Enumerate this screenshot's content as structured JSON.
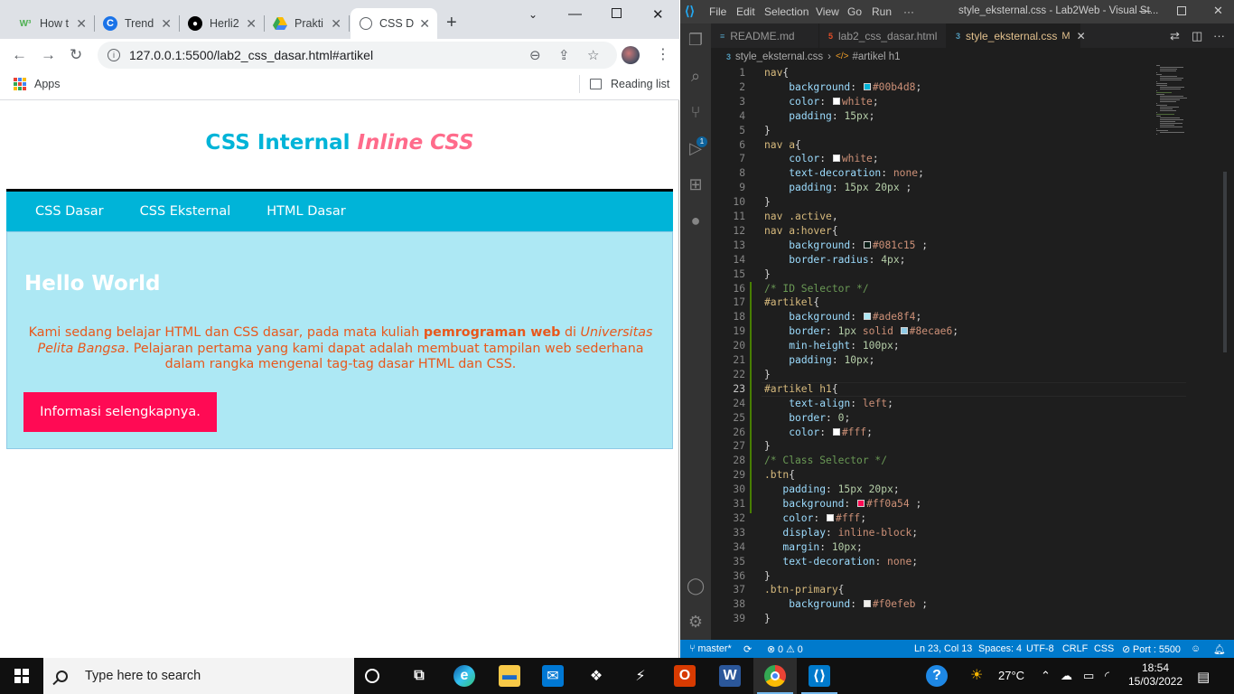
{
  "browser": {
    "tabs": [
      {
        "title": "How t",
        "favicon": "W³",
        "favicon_bg": "#ffffff",
        "favicon_color": "#4caf50"
      },
      {
        "title": "Trend",
        "favicon": "C",
        "favicon_bg": "#1a73e8",
        "favicon_color": "#ffffff"
      },
      {
        "title": "Herli2",
        "favicon": "github",
        "favicon_bg": "#ffffff",
        "favicon_color": "#000000"
      },
      {
        "title": "Prakti",
        "favicon": "drive",
        "favicon_bg": "#ffffff",
        "favicon_color": "#fbbc04"
      },
      {
        "title": "CSS D",
        "favicon": "globe",
        "favicon_bg": "#ffffff",
        "favicon_color": "#5f6368",
        "active": true
      }
    ],
    "url": "127.0.0.1:5500/lab2_css_dasar.html#artikel",
    "bookmarks": {
      "apps": "Apps",
      "reading_list": "Reading list"
    }
  },
  "page": {
    "title_main": "CSS Internal",
    "title_inline": "Inline CSS",
    "nav": [
      "CSS Dasar",
      "CSS Eksternal",
      "HTML Dasar"
    ],
    "article": {
      "heading": "Hello World",
      "p1": "Kami sedang belajar HTML dan CSS dasar, pada mata kuliah ",
      "bold": "pemrograman web",
      "p2": " di ",
      "italic": "Universitas Pelita Bangsa",
      "p3": ". Pelajaran pertama yang kami dapat adalah membuat tampilan web sederhana dalam rangka mengenal tag-tag dasar HTML dan CSS.",
      "button": "Informasi selengkapnya."
    },
    "colors": {
      "nav": "#00b4d8",
      "article_bg": "#ade8f4",
      "button": "#ff0a54",
      "text": "#e8581c"
    }
  },
  "vscode": {
    "menu": [
      "File",
      "Edit",
      "Selection",
      "View",
      "Go",
      "Run",
      "···"
    ],
    "window_title": "style_eksternal.css - Lab2Web - Visual St...",
    "tabs": [
      {
        "label": "README.md",
        "icon": "MD"
      },
      {
        "label": "lab2_css_dasar.html",
        "icon": "5"
      },
      {
        "label": "style_eksternal.css",
        "icon": "3",
        "modified": "M",
        "active": true
      }
    ],
    "breadcrumb": {
      "file": "style_eksternal.css",
      "symbol": "#artikel h1"
    },
    "current_line": 23,
    "code": [
      [
        [
          "sel",
          "nav"
        ],
        [
          "pun",
          "{"
        ]
      ],
      [
        [
          "ind",
          "    "
        ],
        [
          "prop",
          "background"
        ],
        [
          "pun",
          ": "
        ],
        [
          "sw",
          "#00b4d8"
        ],
        [
          "val",
          "#00b4d8"
        ],
        [
          "pun",
          ";"
        ]
      ],
      [
        [
          "ind",
          "    "
        ],
        [
          "prop",
          "color"
        ],
        [
          "pun",
          ": "
        ],
        [
          "sw",
          "#ffffff"
        ],
        [
          "val",
          "white"
        ],
        [
          "pun",
          ";"
        ]
      ],
      [
        [
          "ind",
          "    "
        ],
        [
          "prop",
          "padding"
        ],
        [
          "pun",
          ": "
        ],
        [
          "num",
          "15px"
        ],
        [
          "pun",
          ";"
        ]
      ],
      [
        [
          "pun",
          "}"
        ]
      ],
      [
        [
          "sel",
          "nav a"
        ],
        [
          "pun",
          "{"
        ]
      ],
      [
        [
          "ind",
          "    "
        ],
        [
          "prop",
          "color"
        ],
        [
          "pun",
          ": "
        ],
        [
          "sw",
          "#ffffff"
        ],
        [
          "val",
          "white"
        ],
        [
          "pun",
          ";"
        ]
      ],
      [
        [
          "ind",
          "    "
        ],
        [
          "prop",
          "text-decoration"
        ],
        [
          "pun",
          ": "
        ],
        [
          "val",
          "none"
        ],
        [
          "pun",
          ";"
        ]
      ],
      [
        [
          "ind",
          "    "
        ],
        [
          "prop",
          "padding"
        ],
        [
          "pun",
          ": "
        ],
        [
          "num",
          "15px 20px"
        ],
        [
          "pun",
          " ;"
        ]
      ],
      [
        [
          "pun",
          "}"
        ]
      ],
      [
        [
          "sel",
          "nav .active"
        ],
        [
          "pun",
          ","
        ]
      ],
      [
        [
          "sel",
          "nav a:hover"
        ],
        [
          "pun",
          "{"
        ]
      ],
      [
        [
          "ind",
          "    "
        ],
        [
          "prop",
          "background"
        ],
        [
          "pun",
          ": "
        ],
        [
          "sw",
          "#081c15"
        ],
        [
          "val",
          "#081c15"
        ],
        [
          "pun",
          " ;"
        ]
      ],
      [
        [
          "ind",
          "    "
        ],
        [
          "prop",
          "border-radius"
        ],
        [
          "pun",
          ": "
        ],
        [
          "num",
          "4px"
        ],
        [
          "pun",
          ";"
        ]
      ],
      [
        [
          "pun",
          "}"
        ]
      ],
      [
        [
          "com",
          "/* ID Selector */"
        ]
      ],
      [
        [
          "sel",
          "#artikel"
        ],
        [
          "pun",
          "{"
        ]
      ],
      [
        [
          "ind",
          "    "
        ],
        [
          "prop",
          "background"
        ],
        [
          "pun",
          ": "
        ],
        [
          "sw",
          "#ade8f4"
        ],
        [
          "val",
          "#ade8f4"
        ],
        [
          "pun",
          ";"
        ]
      ],
      [
        [
          "ind",
          "    "
        ],
        [
          "prop",
          "border"
        ],
        [
          "pun",
          ": "
        ],
        [
          "num",
          "1px "
        ],
        [
          "val",
          "solid "
        ],
        [
          "sw",
          "#8ecae6"
        ],
        [
          "val",
          "#8ecae6"
        ],
        [
          "pun",
          ";"
        ]
      ],
      [
        [
          "ind",
          "    "
        ],
        [
          "prop",
          "min-height"
        ],
        [
          "pun",
          ": "
        ],
        [
          "num",
          "100px"
        ],
        [
          "pun",
          ";"
        ]
      ],
      [
        [
          "ind",
          "    "
        ],
        [
          "prop",
          "padding"
        ],
        [
          "pun",
          ": "
        ],
        [
          "num",
          "10px"
        ],
        [
          "pun",
          ";"
        ]
      ],
      [
        [
          "pun",
          "}"
        ]
      ],
      [
        [
          "sel",
          "#artikel h1"
        ],
        [
          "pun",
          "{"
        ]
      ],
      [
        [
          "ind",
          "    "
        ],
        [
          "prop",
          "text-align"
        ],
        [
          "pun",
          ": "
        ],
        [
          "val",
          "left"
        ],
        [
          "pun",
          ";"
        ]
      ],
      [
        [
          "ind",
          "    "
        ],
        [
          "prop",
          "border"
        ],
        [
          "pun",
          ": "
        ],
        [
          "num",
          "0"
        ],
        [
          "pun",
          ";"
        ]
      ],
      [
        [
          "ind",
          "    "
        ],
        [
          "prop",
          "color"
        ],
        [
          "pun",
          ": "
        ],
        [
          "sw",
          "#ffffff"
        ],
        [
          "val",
          "#fff"
        ],
        [
          "pun",
          ";"
        ]
      ],
      [
        [
          "pun",
          "}"
        ]
      ],
      [
        [
          "com",
          "/* Class Selector */"
        ]
      ],
      [
        [
          "sel",
          ".btn"
        ],
        [
          "pun",
          "{"
        ]
      ],
      [
        [
          "ind",
          "   "
        ],
        [
          "prop",
          "padding"
        ],
        [
          "pun",
          ": "
        ],
        [
          "num",
          "15px 20px"
        ],
        [
          "pun",
          ";"
        ]
      ],
      [
        [
          "ind",
          "   "
        ],
        [
          "prop",
          "background"
        ],
        [
          "pun",
          ": "
        ],
        [
          "sw",
          "#ff0a54"
        ],
        [
          "val",
          "#ff0a54"
        ],
        [
          "pun",
          " ;"
        ]
      ],
      [
        [
          "ind",
          "   "
        ],
        [
          "prop",
          "color"
        ],
        [
          "pun",
          ": "
        ],
        [
          "sw",
          "#ffffff"
        ],
        [
          "val",
          "#fff"
        ],
        [
          "pun",
          ";"
        ]
      ],
      [
        [
          "ind",
          "   "
        ],
        [
          "prop",
          "display"
        ],
        [
          "pun",
          ": "
        ],
        [
          "val",
          "inline-block"
        ],
        [
          "pun",
          ";"
        ]
      ],
      [
        [
          "ind",
          "   "
        ],
        [
          "prop",
          "margin"
        ],
        [
          "pun",
          ": "
        ],
        [
          "num",
          "10px"
        ],
        [
          "pun",
          ";"
        ]
      ],
      [
        [
          "ind",
          "   "
        ],
        [
          "prop",
          "text-decoration"
        ],
        [
          "pun",
          ": "
        ],
        [
          "val",
          "none"
        ],
        [
          "pun",
          ";"
        ]
      ],
      [
        [
          "pun",
          "}"
        ]
      ],
      [
        [
          "sel",
          ".btn-primary"
        ],
        [
          "pun",
          "{"
        ]
      ],
      [
        [
          "ind",
          "    "
        ],
        [
          "prop",
          "background"
        ],
        [
          "pun",
          ": "
        ],
        [
          "sw",
          "#f0efeb"
        ],
        [
          "val",
          "#f0efeb"
        ],
        [
          "pun",
          " ;"
        ]
      ],
      [
        [
          "pun",
          "}"
        ]
      ]
    ],
    "status": {
      "branch": "master*",
      "problems_errors": "0",
      "problems_warnings": "0",
      "position": "Ln 23, Col 13",
      "spaces": "Spaces: 4",
      "encoding": "UTF-8",
      "eol": "CRLF",
      "language": "CSS",
      "port": "Port : 5500"
    }
  },
  "taskbar": {
    "search_placeholder": "Type here to search",
    "weather": "27°C",
    "time": "18:54",
    "date": "15/03/2022"
  }
}
